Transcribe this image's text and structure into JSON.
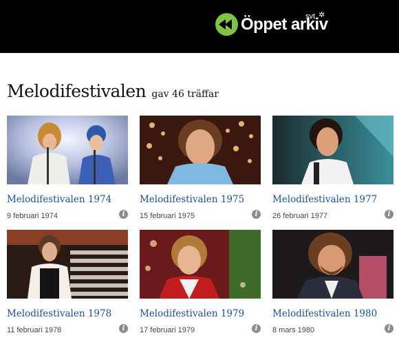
{
  "header": {
    "logo_text": "Öppet arkiv",
    "logo_badge": "svt",
    "logo_icon": "rewind-icon",
    "brand_color": "#7ec642"
  },
  "results": {
    "query": "Melodifestivalen",
    "count_text": "gav 46 träffar"
  },
  "items": [
    {
      "title": "Melodifestivalen 1974",
      "date": "9 februari 1974"
    },
    {
      "title": "Melodifestivalen 1975",
      "date": "15 februari 1975"
    },
    {
      "title": "Melodifestivalen 1977",
      "date": "26 februari 1977"
    },
    {
      "title": "Melodifestivalen 1978",
      "date": "11 februari 1978"
    },
    {
      "title": "Melodifestivalen 1979",
      "date": "17 februari 1979"
    },
    {
      "title": "Melodifestivalen 1980",
      "date": "8 mars 1980"
    }
  ],
  "info_icon": "info-icon",
  "link_color": "#1a4f9c"
}
